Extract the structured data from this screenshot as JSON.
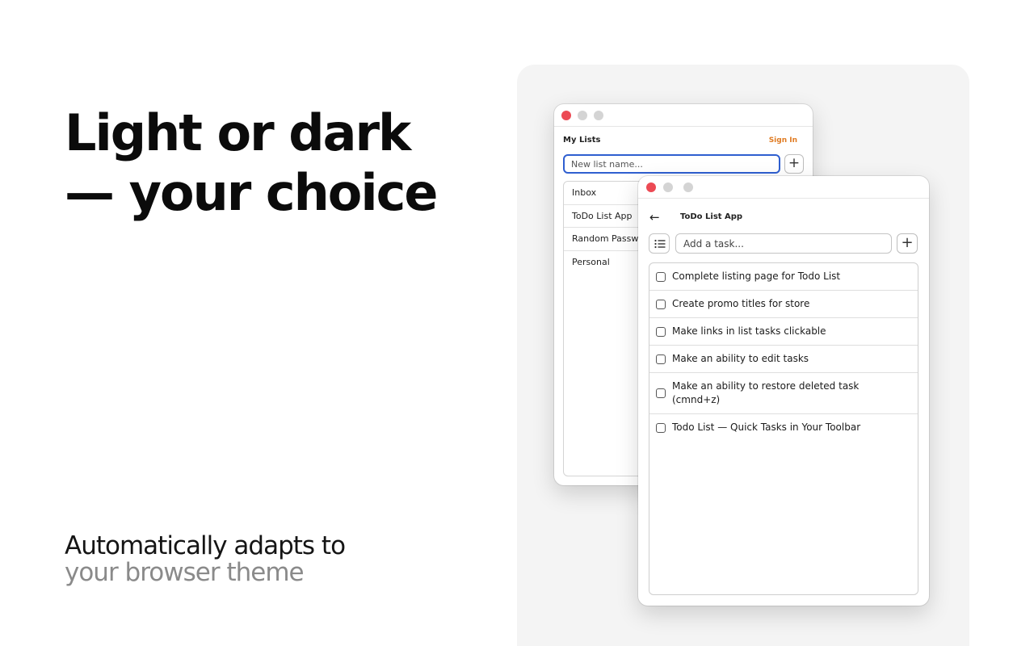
{
  "promo": {
    "headline_line1": "Light or dark",
    "headline_line2": "— your choice",
    "sub_line1": "Automatically adapts to",
    "sub_line2": "your browser theme"
  },
  "lists_window": {
    "title": "My Lists",
    "sign_in": "Sign In",
    "new_list_placeholder": "New list name...",
    "add_icon": "plus-icon",
    "lists": [
      "Inbox",
      "ToDo List App",
      "Random Passwe",
      "Personal"
    ]
  },
  "tasks_window": {
    "back_icon": "arrow-left-icon",
    "title": "ToDo List App",
    "task_placeholder": "Add a task...",
    "tasks": [
      "Complete listing page for Todo List",
      "Create promo titles for store",
      "Make links in list tasks clickable",
      "Make an ability to edit tasks",
      "Make an ability to restore deleted task (cmnd+z)",
      "Todo List — Quick Tasks in Your Toolbar"
    ]
  },
  "colors": {
    "accent_blue": "#2f5fd0",
    "sign_in_orange": "#e07b22",
    "close_red": "#ec4a54",
    "panel_bg": "#f4f4f4"
  }
}
